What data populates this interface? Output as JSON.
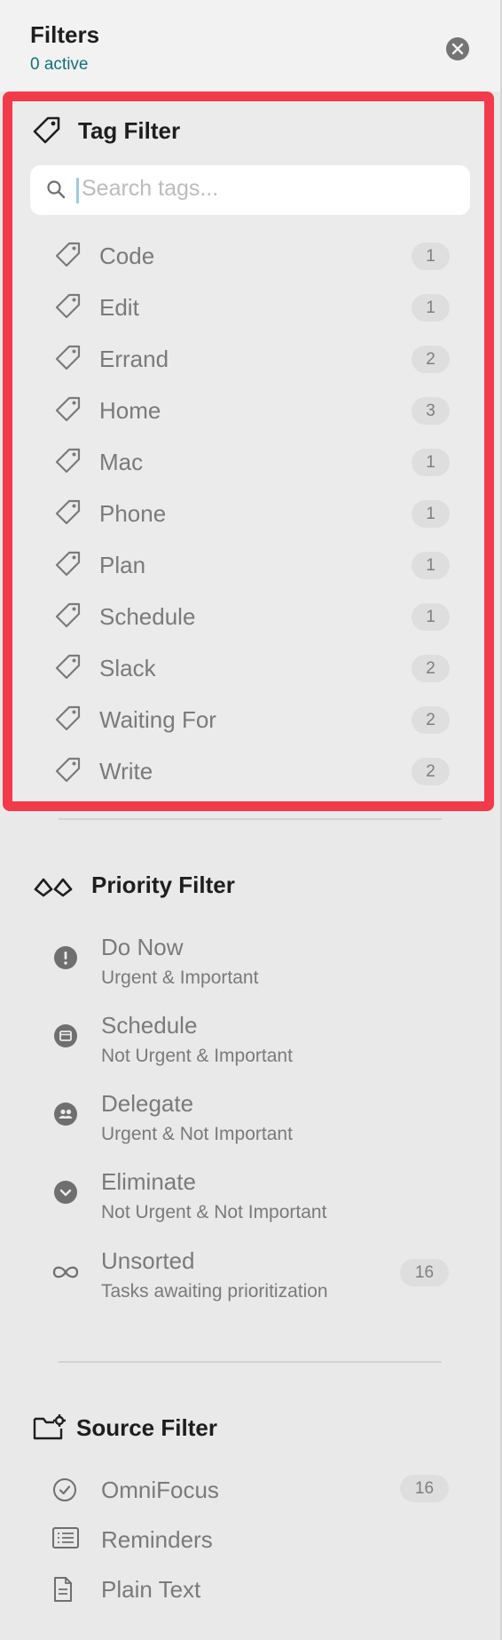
{
  "header": {
    "title": "Filters",
    "active_count": "0 active"
  },
  "tag_filter": {
    "title": "Tag Filter",
    "search_placeholder": "Search tags...",
    "tags": [
      {
        "label": "Code",
        "count": "1"
      },
      {
        "label": "Edit",
        "count": "1"
      },
      {
        "label": "Errand",
        "count": "2"
      },
      {
        "label": "Home",
        "count": "3"
      },
      {
        "label": "Mac",
        "count": "1"
      },
      {
        "label": "Phone",
        "count": "1"
      },
      {
        "label": "Plan",
        "count": "1"
      },
      {
        "label": "Schedule",
        "count": "1"
      },
      {
        "label": "Slack",
        "count": "2"
      },
      {
        "label": "Waiting For",
        "count": "2"
      },
      {
        "label": "Write",
        "count": "2"
      }
    ]
  },
  "priority_filter": {
    "title": "Priority Filter",
    "items": [
      {
        "label": "Do Now",
        "description": "Urgent & Important",
        "icon": "exclamation-circle-icon"
      },
      {
        "label": "Schedule",
        "description": "Not Urgent & Important",
        "icon": "calendar-circle-icon"
      },
      {
        "label": "Delegate",
        "description": "Urgent & Not Important",
        "icon": "people-circle-icon"
      },
      {
        "label": "Eliminate",
        "description": "Not Urgent & Not Important",
        "icon": "chevron-down-circle-icon"
      },
      {
        "label": "Unsorted",
        "description": "Tasks awaiting prioritization",
        "icon": "infinity-icon",
        "count": "16"
      }
    ]
  },
  "source_filter": {
    "title": "Source Filter",
    "items": [
      {
        "label": "OmniFocus",
        "icon": "checkmark-circle-icon",
        "count": "16"
      },
      {
        "label": "Reminders",
        "icon": "list-icon"
      },
      {
        "label": "Plain Text",
        "icon": "document-icon"
      }
    ]
  },
  "colors": {
    "highlight_border": "#f33a4a",
    "active_count_text": "#12707a",
    "panel_background": "#e9e9e9"
  }
}
